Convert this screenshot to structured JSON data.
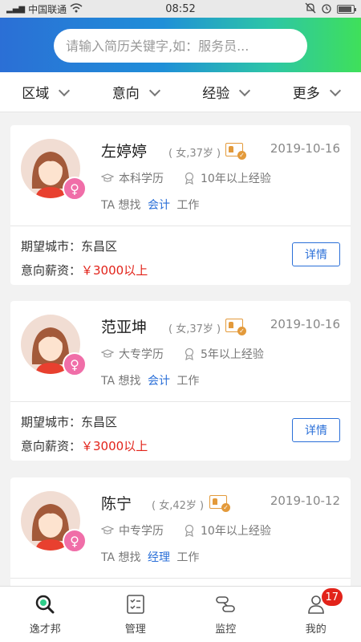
{
  "statusbar": {
    "carrier": "中国联通",
    "time": "08:52"
  },
  "search": {
    "placeholder": "请输入简历关键字,如：服务员..."
  },
  "filters": [
    {
      "label": "区域"
    },
    {
      "label": "意向"
    },
    {
      "label": "经验"
    },
    {
      "label": "更多"
    }
  ],
  "cards": [
    {
      "name": "左婷婷",
      "meta": "( 女,37岁 )",
      "date": "2019-10-16",
      "education": "本科学历",
      "experience": "10年以上经验",
      "seek_prefix": "TA 想找",
      "job": "会计",
      "seek_suffix": "工作",
      "city_label": "期望城市：",
      "city": "东昌区",
      "salary_label": "意向薪资：",
      "salary": "￥3000以上",
      "detail_label": "详情"
    },
    {
      "name": "范亚坤",
      "meta": "( 女,37岁 )",
      "date": "2019-10-16",
      "education": "大专学历",
      "experience": "5年以上经验",
      "seek_prefix": "TA 想找",
      "job": "会计",
      "seek_suffix": "工作",
      "city_label": "期望城市：",
      "city": "东昌区",
      "salary_label": "意向薪资：",
      "salary": "￥3000以上",
      "detail_label": "详情"
    },
    {
      "name": "陈宁",
      "meta": "( 女,42岁 )",
      "date": "2019-10-12",
      "education": "中专学历",
      "experience": "10年以上经验",
      "seek_prefix": "TA 想找",
      "job": "经理",
      "seek_suffix": "工作"
    }
  ],
  "tabbar": [
    {
      "label": "逸才邦",
      "icon": "search-home-icon"
    },
    {
      "label": "管理",
      "icon": "checklist-icon"
    },
    {
      "label": "监控",
      "icon": "link-icon"
    },
    {
      "label": "我的",
      "icon": "user-icon",
      "badge": "17"
    }
  ],
  "colors": {
    "accent": "#2a6fd8",
    "salary": "#e2231a",
    "female": "#f06ea8",
    "badge": "#e2231a"
  }
}
